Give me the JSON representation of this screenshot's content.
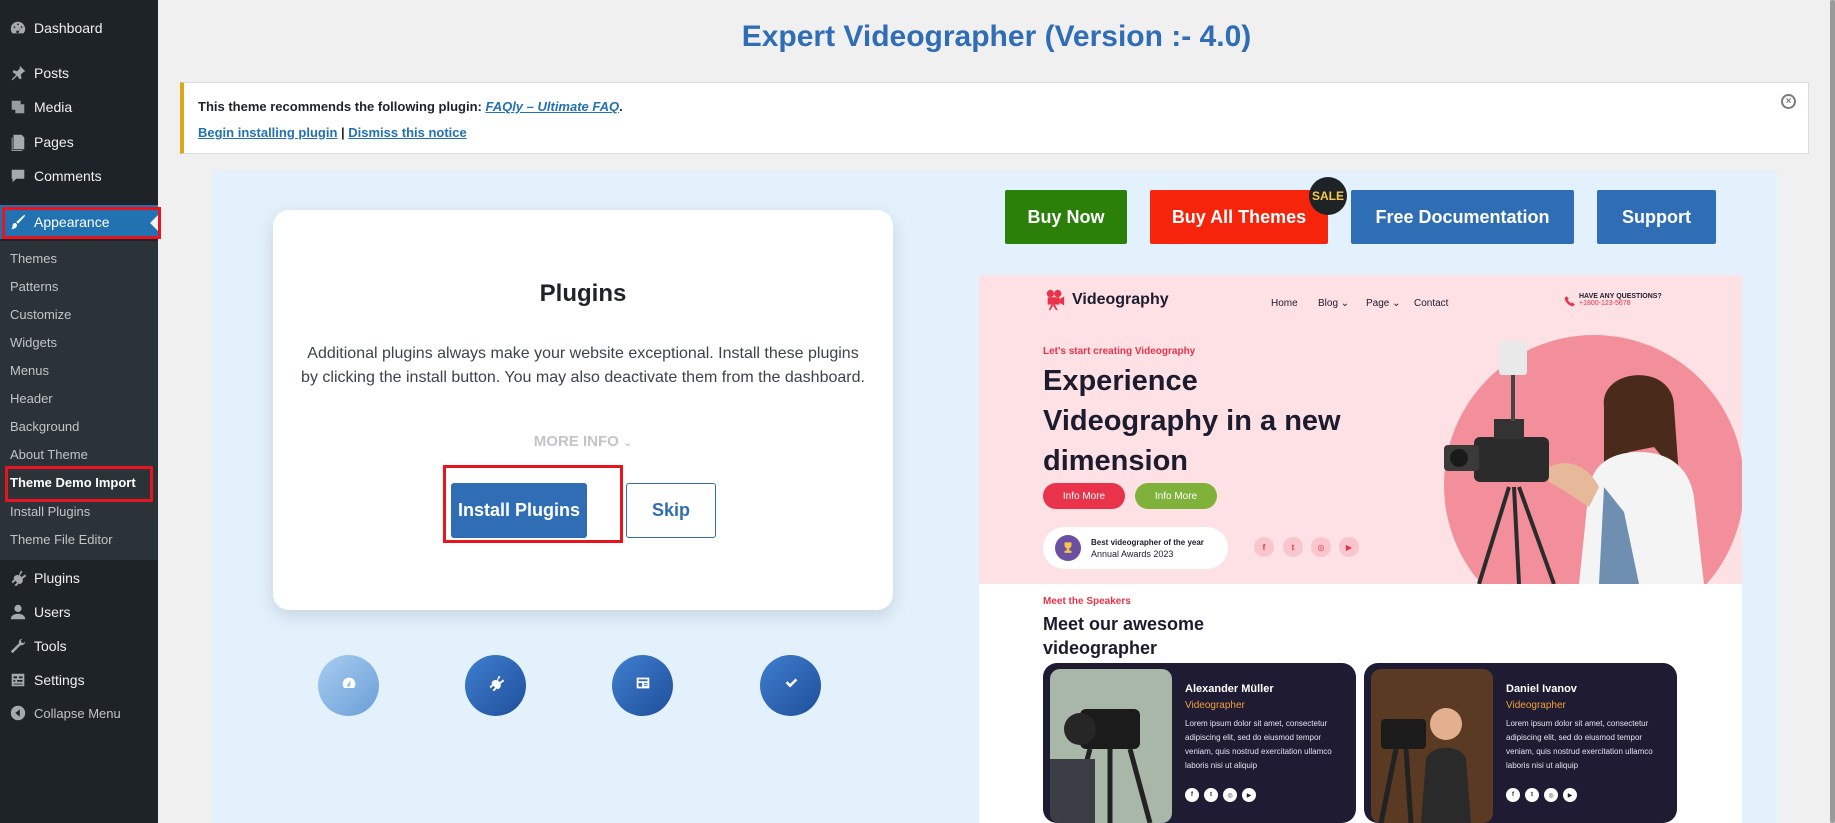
{
  "sidebar": {
    "items": [
      {
        "label": "Dashboard",
        "icon": "dashboard-icon"
      },
      {
        "label": "Posts",
        "icon": "pin-icon"
      },
      {
        "label": "Media",
        "icon": "media-icon"
      },
      {
        "label": "Pages",
        "icon": "pages-icon"
      },
      {
        "label": "Comments",
        "icon": "comment-icon"
      },
      {
        "label": "Appearance",
        "icon": "brush-icon"
      },
      {
        "label": "Plugins",
        "icon": "plugin-icon"
      },
      {
        "label": "Users",
        "icon": "user-icon"
      },
      {
        "label": "Tools",
        "icon": "wrench-icon"
      },
      {
        "label": "Settings",
        "icon": "settings-icon"
      },
      {
        "label": "Collapse Menu",
        "icon": "collapse-icon"
      }
    ],
    "submenu": [
      "Themes",
      "Patterns",
      "Customize",
      "Widgets",
      "Menus",
      "Header",
      "Background",
      "About Theme",
      "Theme Demo Import",
      "Install Plugins",
      "Theme File Editor"
    ]
  },
  "page": {
    "title": "Expert Videographer (Version :- 4.0)"
  },
  "notice": {
    "text": "This theme recommends the following plugin: ",
    "plugin_link": "FAQly – Ultimate FAQ",
    "period": ".",
    "begin_link": "Begin installing plugin",
    "separator": " | ",
    "dismiss_link": "Dismiss this notice"
  },
  "card": {
    "title": "Plugins",
    "description": "Additional plugins always make your website exceptional. Install these plugins by clicking the install button. You may also deactivate them from the dashboard.",
    "more_info": "MORE INFO",
    "install_label": "Install Plugins",
    "skip_label": "Skip"
  },
  "top_buttons": {
    "buy_now": "Buy Now",
    "buy_all": "Buy All Themes",
    "sale": "SALE",
    "docs": "Free Documentation",
    "support": "Support"
  },
  "preview": {
    "logo": "Videography",
    "nav": [
      "Home",
      "Blog",
      "Page",
      "Contact"
    ],
    "questions": "HAVE ANY QUESTIONS?",
    "phone": "+1800-123-5678",
    "tagline": "Let's start creating Videography",
    "headline": "Experience Videography in a new dimension",
    "btn1": "Info More",
    "btn2": "Info More",
    "award_title": "Best videographer of the year",
    "award_sub": "Annual Awards 2023",
    "speakers_tag": "Meet the Speakers",
    "speakers_title": "Meet our awesome videographer",
    "speakers": [
      {
        "name": "Alexander Müller",
        "role": "Videographer",
        "desc": "Lorem ipsum dolor sit amet, consectetur adipiscing elit, sed do eiusmod tempor veniam, quis nostrud exercitation ullamco laboris nisi ut aliquip"
      },
      {
        "name": "Daniel Ivanov",
        "role": "Videographer",
        "desc": "Lorem ipsum dolor sit amet, consectetur adipiscing elit, sed do eiusmod tempor veniam, quis nostrud exercitation ullamco laboris nisi ut aliquip"
      }
    ]
  },
  "colors": {
    "accent": "#2f6db5",
    "buy_now": "#2a8009",
    "buy_all": "#f5240b",
    "highlight": "#e8141f"
  }
}
